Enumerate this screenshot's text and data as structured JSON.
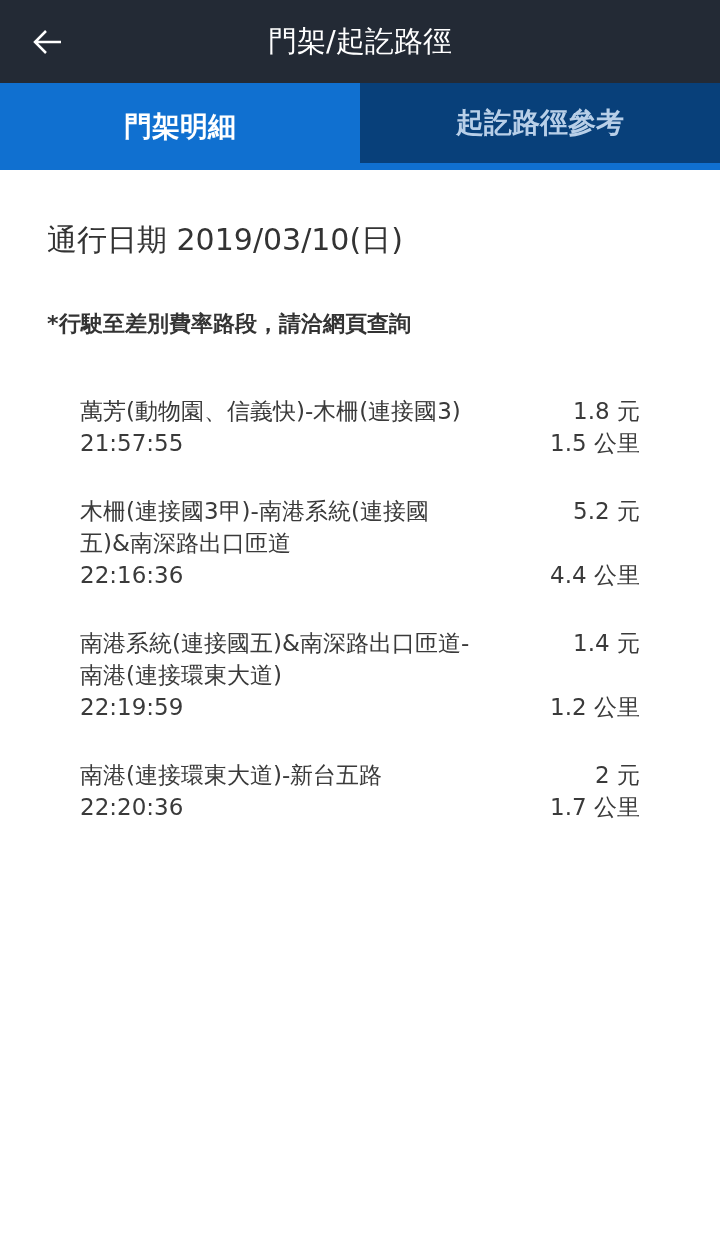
{
  "header": {
    "title": "門架/起訖路徑"
  },
  "tabs": [
    {
      "label": "門架明細",
      "selected": true
    },
    {
      "label": "起訖路徑參考",
      "selected": false
    }
  ],
  "date": "通行日期 2019/03/10(日)",
  "note": "*行駛至差別費率路段，請洽網頁查詢",
  "segments": [
    {
      "name": "萬芳(動物園、信義快)-木柵(連接國3)",
      "fare": "1.8 元",
      "time": "21:57:55",
      "distance": "1.5 公里"
    },
    {
      "name": "木柵(連接國3甲)-南港系統(連接國五)&南深路出口匝道",
      "fare": "5.2 元",
      "time": "22:16:36",
      "distance": "4.4 公里"
    },
    {
      "name": "南港系統(連接國五)&南深路出口匝道-南港(連接環東大道)",
      "fare": "1.4 元",
      "time": "22:19:59",
      "distance": "1.2 公里"
    },
    {
      "name": "南港(連接環東大道)-新台五路",
      "fare": "2 元",
      "time": "22:20:36",
      "distance": "1.7 公里"
    }
  ]
}
